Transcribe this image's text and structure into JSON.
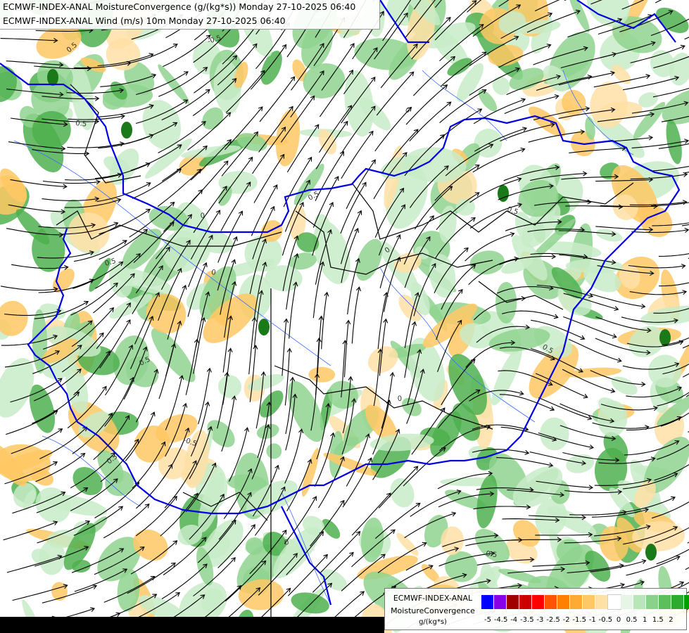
{
  "header": {
    "line1": "ECMWF-INDEX-ANAL MoistureConvergence (g/(kg*s)) Monday 27-10-2025 06:40",
    "line2": "ECMWF-INDEX-ANAL Wind (m/s) 10m Monday 27-10-2025 06:40"
  },
  "legend": {
    "line1": "ECMWF-INDEX-ANAL",
    "line2": "MoistureConvergence",
    "unit": "g/(kg*s)",
    "colors": [
      "#0000ff",
      "#8a00e6",
      "#a00000",
      "#cc0000",
      "#ff0000",
      "#ff5500",
      "#ff8000",
      "#ffaa33",
      "#ffc864",
      "#ffe0a6",
      "#ffffff",
      "#e6f5e6",
      "#b8e6b8",
      "#8ad28a",
      "#5cbf5c",
      "#2eaa2e",
      "#00a000"
    ],
    "tick_labels": [
      "-5",
      "-4.5",
      "-4",
      "-3.5",
      "-3",
      "-2.5",
      "-2",
      "-1.5",
      "-1",
      "-0.5",
      "0",
      "0.5",
      "1",
      "1.5",
      "2"
    ]
  },
  "contour_labels": [
    "0.5",
    "-0.5",
    "0.5",
    "0",
    "0.5",
    "0",
    "0.5",
    "0",
    "0.5",
    "0",
    "0.5",
    "0.5",
    "0",
    "-0.5",
    "0.5",
    "0",
    "0.5"
  ],
  "colors": {
    "border": "#0000dd",
    "river": "#3060ff",
    "streamline": "#000000",
    "green_light": "#c8ebc8",
    "green_mid": "#8fd48f",
    "green_dark": "#4fb04f",
    "orange_light": "#ffe0a6",
    "orange_mid": "#ffc864"
  }
}
